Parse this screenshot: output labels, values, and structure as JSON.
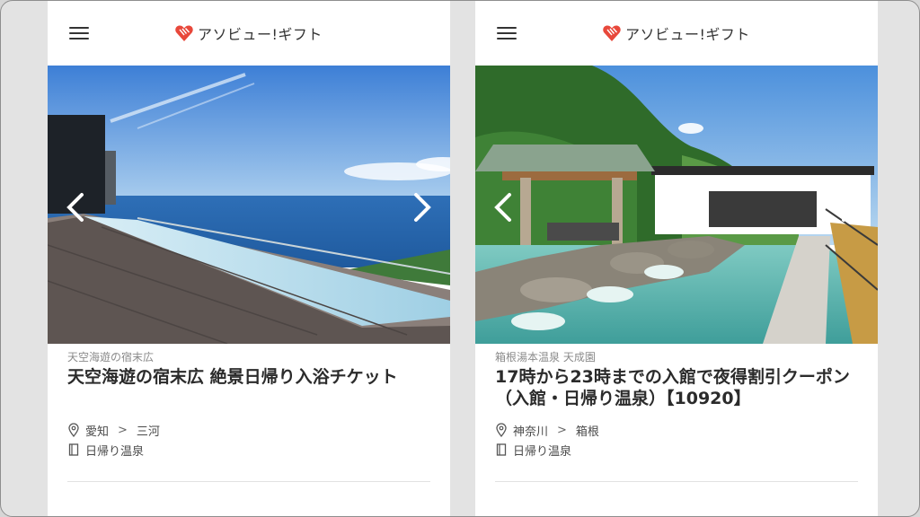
{
  "brand": {
    "logo_text": "アソビュー!ギフト",
    "logo_color": "#e8483b"
  },
  "cards": [
    {
      "venue": "天空海遊の宿末広",
      "title": "天空海遊の宿末広 絶景日帰り入浴チケット",
      "location": {
        "prefecture": "愛知",
        "separator": ">",
        "area": "三河"
      },
      "category": "日帰り温泉",
      "image_description": "rooftop infinity pool overlooking blue sea"
    },
    {
      "venue": "箱根湯本温泉 天成園",
      "title": "17時から23時までの入館で夜得割引クーポン（入館・日帰り温泉）【10920】",
      "location": {
        "prefecture": "神奈川",
        "separator": ">",
        "area": "箱根"
      },
      "category": "日帰り温泉",
      "image_description": "outdoor rock hot spring bath with wooden pavilion and green hills"
    }
  ],
  "icons": {
    "menu": "hamburger-menu-icon",
    "prev": "chevron-left-icon",
    "next": "chevron-right-icon",
    "location": "map-pin-icon",
    "category": "book-icon"
  },
  "colors": {
    "accent": "#e8483b",
    "title_text": "#2b2b2b",
    "sub_text": "#8a8a8a"
  }
}
